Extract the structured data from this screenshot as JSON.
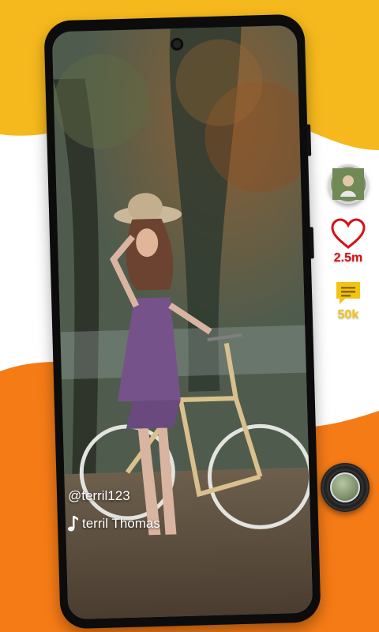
{
  "colors": {
    "accent_yellow": "#f6b91d",
    "accent_orange": "#f57b16",
    "like_red": "#d80f14",
    "comment_yellow": "#f2c311"
  },
  "actions": {
    "like": {
      "icon": "heart-outline-icon",
      "count": "2.5m"
    },
    "comment": {
      "icon": "comment-icon",
      "count": "50k"
    },
    "share": {
      "icon": "share-arrow-icon"
    }
  },
  "post": {
    "username": "@terril123",
    "music_icon": "music-note-icon",
    "music_label": "terril Thomas"
  }
}
